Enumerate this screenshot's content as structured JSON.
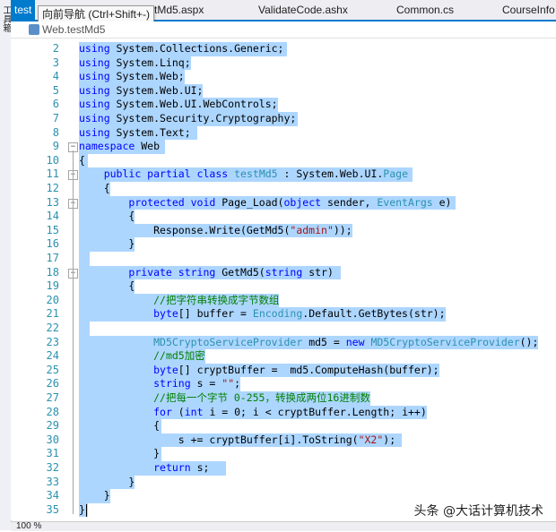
{
  "toolbox": {
    "label": "工具箱"
  },
  "tabs": [
    {
      "label": "test",
      "active": true
    },
    {
      "label": "tMd5.aspx",
      "active": false
    },
    {
      "label": "ValidateCode.ashx",
      "active": false
    },
    {
      "label": "Common.cs",
      "active": false
    },
    {
      "label": "CourseInfo",
      "active": false
    }
  ],
  "tooltip": "向前导航 (Ctrl+Shift+-)",
  "nav": {
    "type_combo": "Web.testMd5"
  },
  "status": {
    "zoom": "100 %"
  },
  "watermark": "头条 @大话计算机技术",
  "code_lines": [
    {
      "n": "2"
    },
    {
      "n": "3"
    },
    {
      "n": "4"
    },
    {
      "n": "5"
    },
    {
      "n": "6"
    },
    {
      "n": "7"
    },
    {
      "n": "8"
    },
    {
      "n": "9"
    },
    {
      "n": "10"
    },
    {
      "n": "11"
    },
    {
      "n": "12"
    },
    {
      "n": "13"
    },
    {
      "n": "14"
    },
    {
      "n": "15"
    },
    {
      "n": "16"
    },
    {
      "n": "17"
    },
    {
      "n": "18"
    },
    {
      "n": "19"
    },
    {
      "n": "20"
    },
    {
      "n": "21"
    },
    {
      "n": "22"
    },
    {
      "n": "23"
    },
    {
      "n": "24"
    },
    {
      "n": "25"
    },
    {
      "n": "26"
    },
    {
      "n": "27"
    },
    {
      "n": "28"
    },
    {
      "n": "29"
    },
    {
      "n": "30"
    },
    {
      "n": "31"
    },
    {
      "n": "32"
    },
    {
      "n": "33"
    },
    {
      "n": "34"
    },
    {
      "n": "35"
    }
  ],
  "code_text": {
    "l2": [
      "using",
      " System.Collections.Generic;"
    ],
    "l3": [
      "using",
      " System.Linq;"
    ],
    "l4": [
      "using",
      " System.Web;"
    ],
    "l5": [
      "using",
      " System.Web.UI;"
    ],
    "l6": [
      "using",
      " System.Web.UI.WebControls;"
    ],
    "l7": [
      "using",
      " System.Security.Cryptography;"
    ],
    "l8": [
      "using",
      " System.Text;"
    ],
    "l9": [
      "namespace",
      " Web"
    ],
    "l10": "{",
    "l11": [
      "    ",
      "public partial class",
      " ",
      "testMd5",
      " : System.Web.UI.",
      "Page"
    ],
    "l12": "    {",
    "l13": [
      "        ",
      "protected void",
      " Page_Load(",
      "object",
      " sender, ",
      "EventArgs",
      " e)"
    ],
    "l14": "        {",
    "l15": [
      "            Response.Write(GetMd5(",
      "\"admin\"",
      "));"
    ],
    "l16": "        }",
    "l18": [
      "        ",
      "private string",
      " GetMd5(",
      "string",
      " str)"
    ],
    "l19": "        {",
    "l20": [
      "            ",
      "//把字符串转换成字节数组"
    ],
    "l21": [
      "            ",
      "byte",
      "[] buffer = ",
      "Encoding",
      ".Default.GetBytes(str);"
    ],
    "l23": [
      "            ",
      "MD5CryptoServiceProvider",
      " md5 = ",
      "new",
      " ",
      "MD5CryptoServiceProvider",
      "();"
    ],
    "l24": [
      "            ",
      "//md5加密"
    ],
    "l25": [
      "            ",
      "byte",
      "[] cryptBuffer =  md5.ComputeHash(buffer);"
    ],
    "l26": [
      "            ",
      "string",
      " s = ",
      "\"\"",
      ";"
    ],
    "l27": [
      "            ",
      "//把每一个字节 0-255，转换成两位16进制数"
    ],
    "l28": [
      "            ",
      "for",
      " (",
      "int",
      " i = 0; i < cryptBuffer.Length; i++)"
    ],
    "l29": "            {",
    "l30": [
      "                s += cryptBuffer[i].ToString(",
      "\"X2\"",
      ");"
    ],
    "l31": "            }",
    "l32": [
      "            ",
      "return",
      " s;"
    ],
    "l33": "        }",
    "l34": "    }",
    "l35": "}"
  }
}
